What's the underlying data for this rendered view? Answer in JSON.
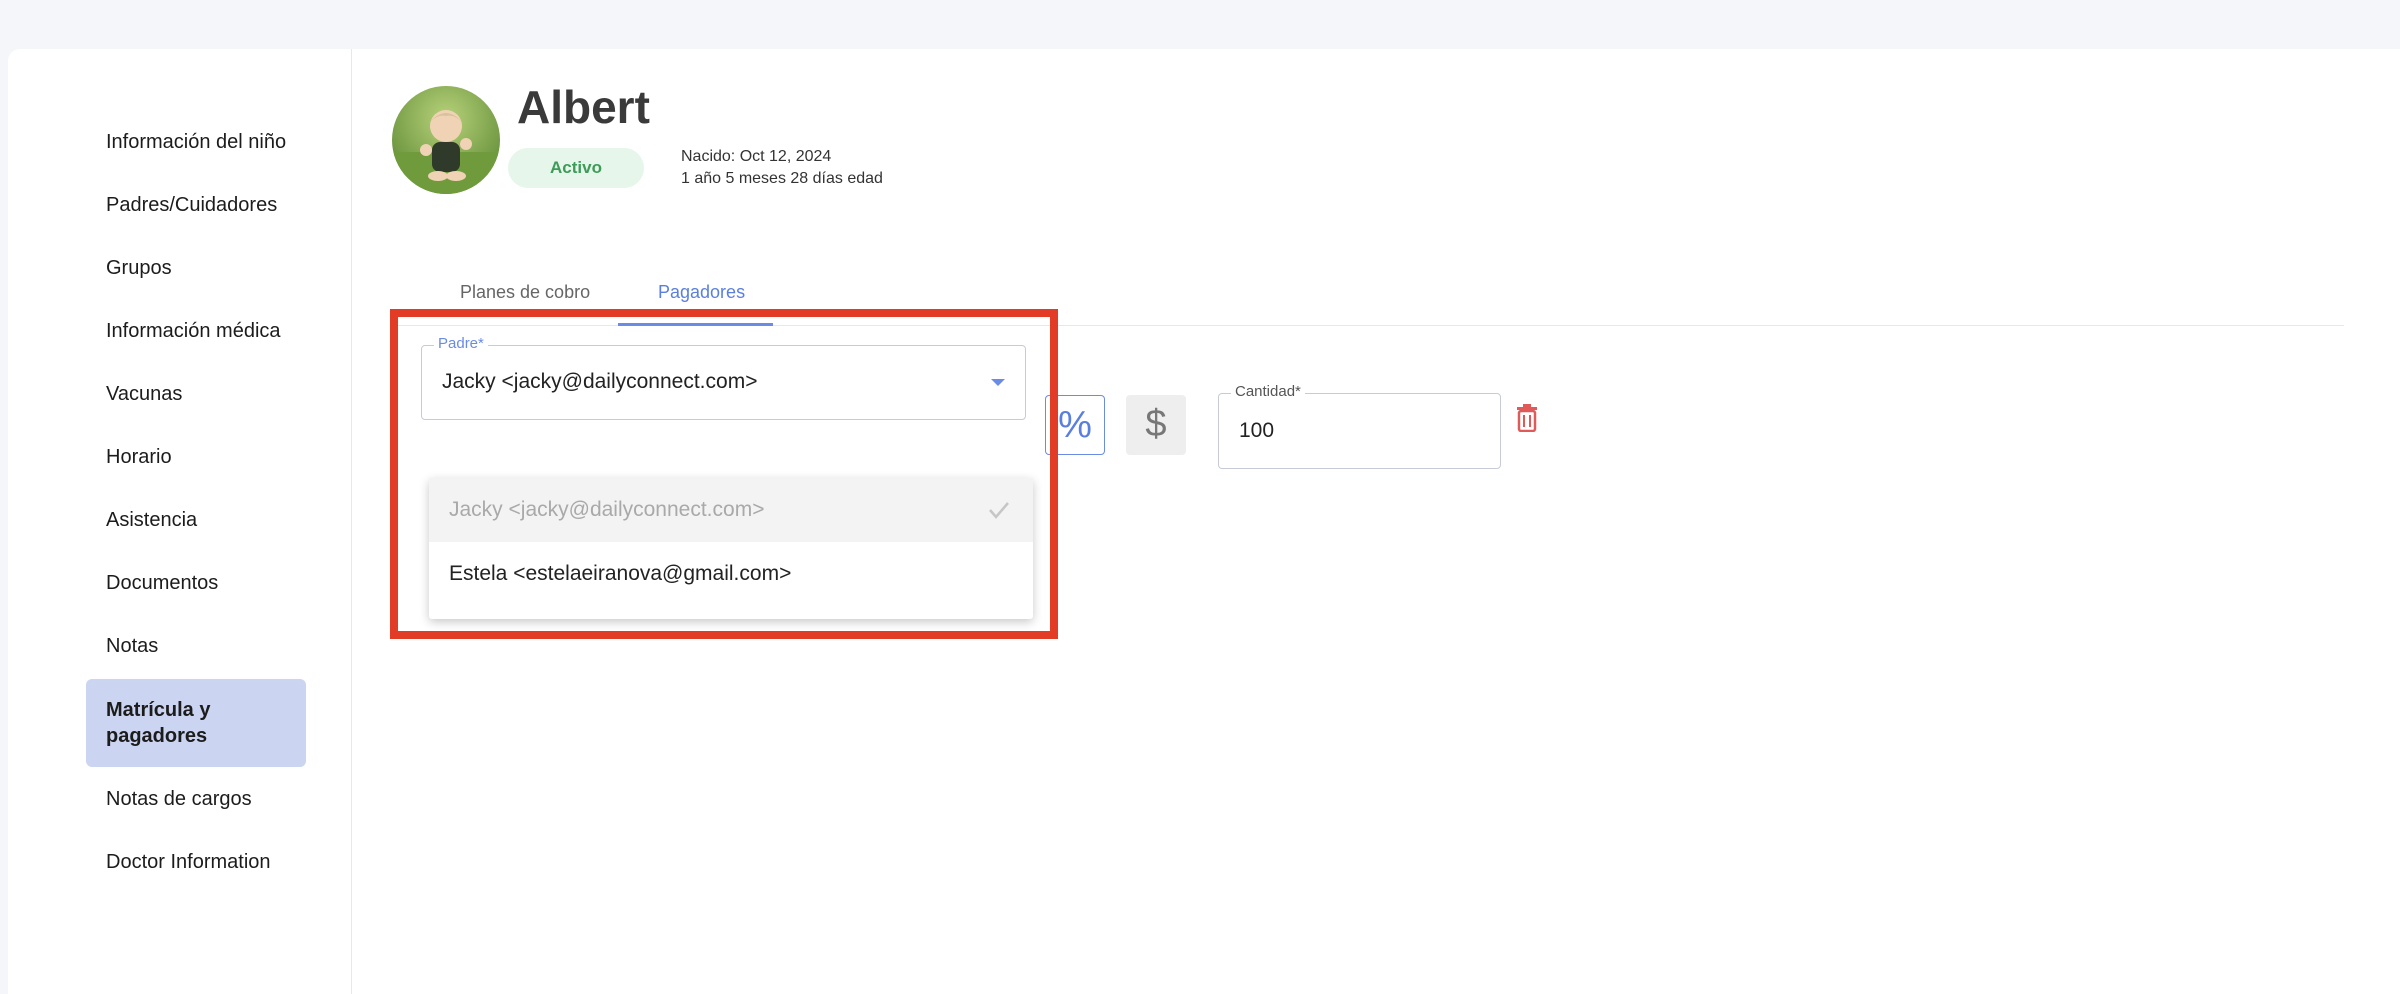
{
  "sidebar": {
    "items": [
      {
        "label": "Información del niño"
      },
      {
        "label": "Padres/Cuidadores"
      },
      {
        "label": "Grupos"
      },
      {
        "label": "Información médica"
      },
      {
        "label": "Vacunas"
      },
      {
        "label": "Horario"
      },
      {
        "label": "Asistencia"
      },
      {
        "label": "Documentos"
      },
      {
        "label": "Notas"
      },
      {
        "label": "Matrícula y pagadores"
      },
      {
        "label": "Notas de cargos"
      },
      {
        "label": "Doctor Information"
      }
    ],
    "active_index": 9
  },
  "child": {
    "name": "Albert",
    "status": "Activo",
    "born": "Nacido: Oct 12, 2024",
    "age": "1 año 5 meses 28 días edad"
  },
  "tabs": [
    {
      "label": "Planes de cobro"
    },
    {
      "label": "Pagadores"
    }
  ],
  "active_tab": "Pagadores",
  "payer": {
    "parent_label": "Padre*",
    "selected_value": "Jacky <jacky@dailyconnect.com>",
    "options": [
      {
        "label": "Jacky <jacky@dailyconnect.com>",
        "selected": true
      },
      {
        "label": "Estela <estelaeiranova@gmail.com>",
        "selected": false
      }
    ],
    "percent_symbol": "%",
    "dollar_symbol": "$",
    "amount_label": "Cantidad*",
    "amount_value": "100"
  },
  "colors": {
    "accent": "#6a8be6",
    "highlight": "#e23b26",
    "status_bg": "#e6f6ea",
    "status_text": "#3e9b58",
    "active_nav_bg": "#cbd5f1",
    "delete": "#e05a5a"
  },
  "icons": {
    "check": "check-icon",
    "caret": "caret-down-icon",
    "delete": "trash-icon"
  }
}
